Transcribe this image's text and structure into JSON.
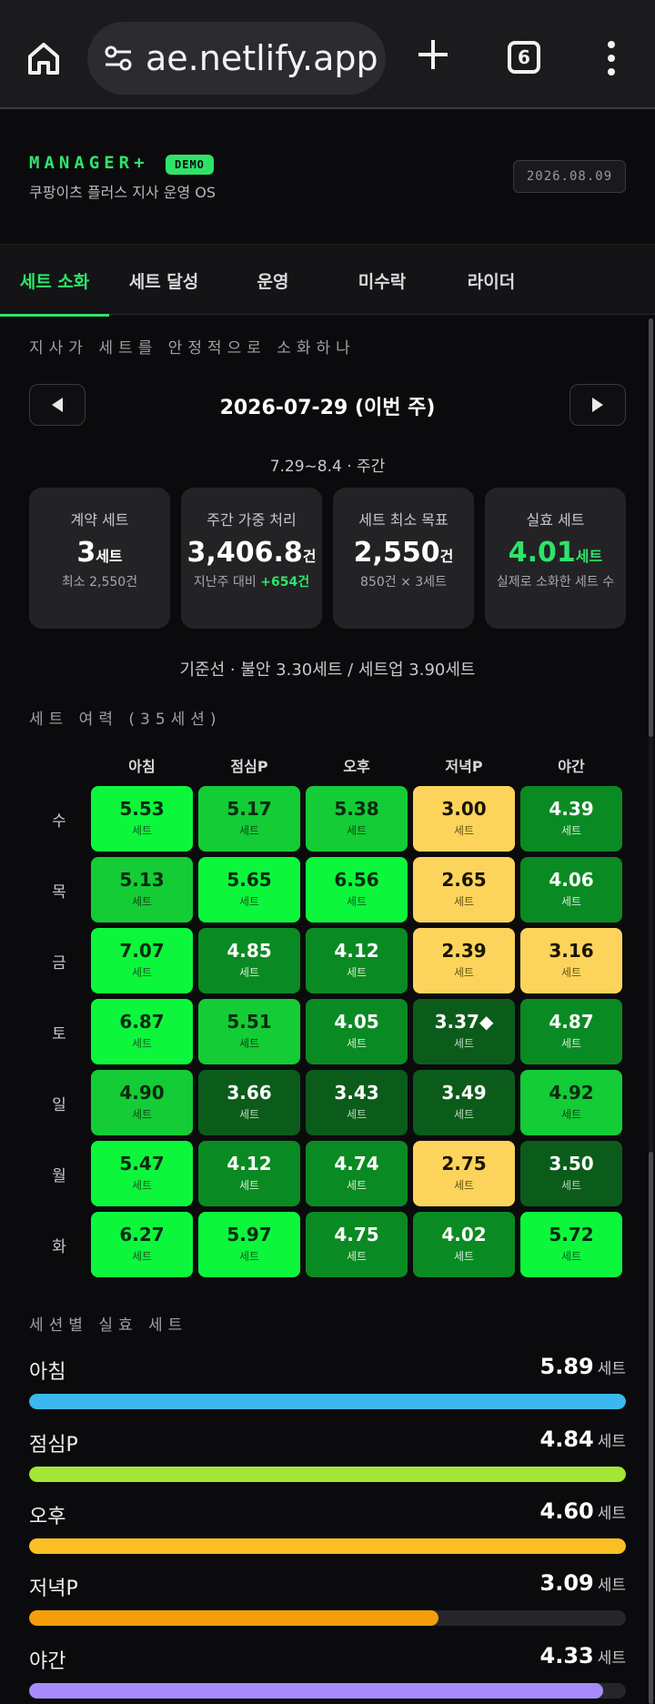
{
  "browser": {
    "url": "ae.netlify.app",
    "tab_count": "6",
    "icons": [
      "home-icon",
      "page-settings-icon",
      "plus-icon",
      "tabs-icon",
      "more-vert-icon"
    ]
  },
  "header": {
    "brand": "MANAGER+",
    "badge": "DEMO",
    "subtitle": "쿠팡이츠 플러스 지사 운영 OS",
    "date": "2026.08.09"
  },
  "tabs": [
    {
      "label": "세트 소화",
      "active": true
    },
    {
      "label": "세트 달성",
      "active": false
    },
    {
      "label": "운영",
      "active": false
    },
    {
      "label": "미수락",
      "active": false
    },
    {
      "label": "라이더",
      "active": false
    }
  ],
  "intro": "지사가 세트를 안정적으로 소화하나",
  "week": {
    "title": "2026-07-29 (이번 주)",
    "range": "7.29~8.4 · 주간",
    "prev_icon": "triangle-left-icon",
    "next_icon": "triangle-right-icon"
  },
  "kpis": [
    {
      "label": "계약 세트",
      "value": "3",
      "unit": "세트",
      "sub": "최소 2,550건",
      "delta": ""
    },
    {
      "label": "주간 가중 처리",
      "value": "3,406.8",
      "unit": "건",
      "sub": "지난주 대비 ",
      "delta": "+654건"
    },
    {
      "label": "세트 최소 목표",
      "value": "2,550",
      "unit": "건",
      "sub": "850건 × 3세트",
      "delta": ""
    },
    {
      "label": "실효 세트",
      "value": "4.01",
      "unit": "세트",
      "sub": "실제로 소화한 세트 수",
      "delta": ""
    }
  ],
  "baseline": "기준선 · 불안 3.30세트 / 세트업 3.90세트",
  "capacity": {
    "title": "세트 여력 (35세션)",
    "columns": [
      "아침",
      "점심P",
      "오후",
      "저녁P",
      "야간"
    ],
    "unit": "세트",
    "rows": [
      {
        "day": "수",
        "values": [
          "5.53",
          "5.17",
          "5.38",
          "3.00",
          "4.39"
        ]
      },
      {
        "day": "목",
        "values": [
          "5.13",
          "5.65",
          "6.56",
          "2.65",
          "4.06"
        ]
      },
      {
        "day": "금",
        "values": [
          "7.07",
          "4.85",
          "4.12",
          "2.39",
          "3.16"
        ]
      },
      {
        "day": "토",
        "values": [
          "6.87",
          "5.51",
          "4.05",
          "3.37◆",
          "4.87"
        ]
      },
      {
        "day": "일",
        "values": [
          "4.90",
          "3.66",
          "3.43",
          "3.49",
          "4.92"
        ]
      },
      {
        "day": "월",
        "values": [
          "5.47",
          "4.12",
          "4.74",
          "2.75",
          "3.50"
        ]
      },
      {
        "day": "화",
        "values": [
          "6.27",
          "5.97",
          "4.75",
          "4.02",
          "5.72"
        ]
      }
    ]
  },
  "session_sets": {
    "title": "세션별 실효 세트",
    "unit": "세트",
    "scale_max": 4.5,
    "items": [
      {
        "name": "아침",
        "value": "5.89",
        "color": "#3bb8f0"
      },
      {
        "name": "점심P",
        "value": "4.84",
        "color": "#a3e635"
      },
      {
        "name": "오후",
        "value": "4.60",
        "color": "#fbbf24"
      },
      {
        "name": "저녁P",
        "value": "3.09",
        "color": "#f59e0b"
      },
      {
        "name": "야간",
        "value": "4.33",
        "color": "#a78bfa"
      }
    ]
  }
}
